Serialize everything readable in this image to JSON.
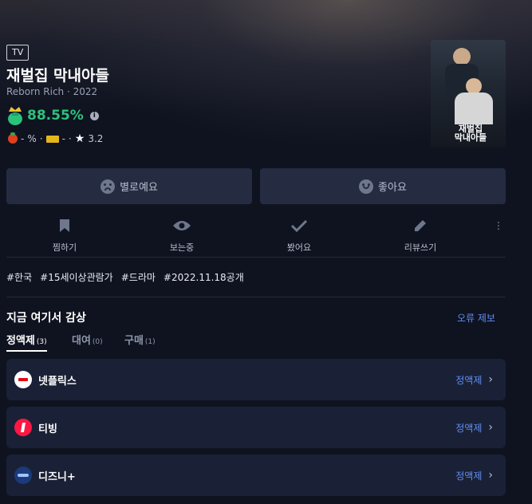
{
  "header": {
    "type_badge": "TV",
    "title": "재벌집 막내아들",
    "subtitle": "Reborn Rich · 2022",
    "score": "88.55%",
    "info_glyph": "i"
  },
  "ratings": {
    "tomato_value": "-",
    "tomato_unit": "%",
    "sep1": "·",
    "imdb_value": "-",
    "sep2": "·",
    "star_value": "3.2"
  },
  "poster": {
    "title_text": "재벌집\n막내아들"
  },
  "votes": {
    "dislike": "별로예요",
    "like": "좋아요"
  },
  "actions": [
    {
      "label": "찜하기",
      "icon": "bookmark-icon"
    },
    {
      "label": "보는중",
      "icon": "eye-icon"
    },
    {
      "label": "봤어요",
      "icon": "check-icon"
    },
    {
      "label": "리뷰쓰기",
      "icon": "pencil-icon"
    }
  ],
  "tags": [
    "#한국",
    "#15세이상관람가",
    "#드라마",
    "#2022.11.18공개"
  ],
  "watch": {
    "title": "지금 여기서 감상",
    "report": "오류 제보",
    "tabs": [
      {
        "label": "정액제",
        "count": "(3)"
      },
      {
        "label": "대여",
        "count": "(0)"
      },
      {
        "label": "구매",
        "count": "(1)"
      }
    ],
    "services": [
      {
        "name": "넷플릭스",
        "plan": "정액제"
      },
      {
        "name": "티빙",
        "plan": "정액제"
      },
      {
        "name": "디즈니+",
        "plan": "정액제"
      }
    ]
  },
  "colors": {
    "background": "#0f1320",
    "score_green": "#2bc27b",
    "link_blue": "#5f8df5",
    "card": "#1a2136"
  }
}
